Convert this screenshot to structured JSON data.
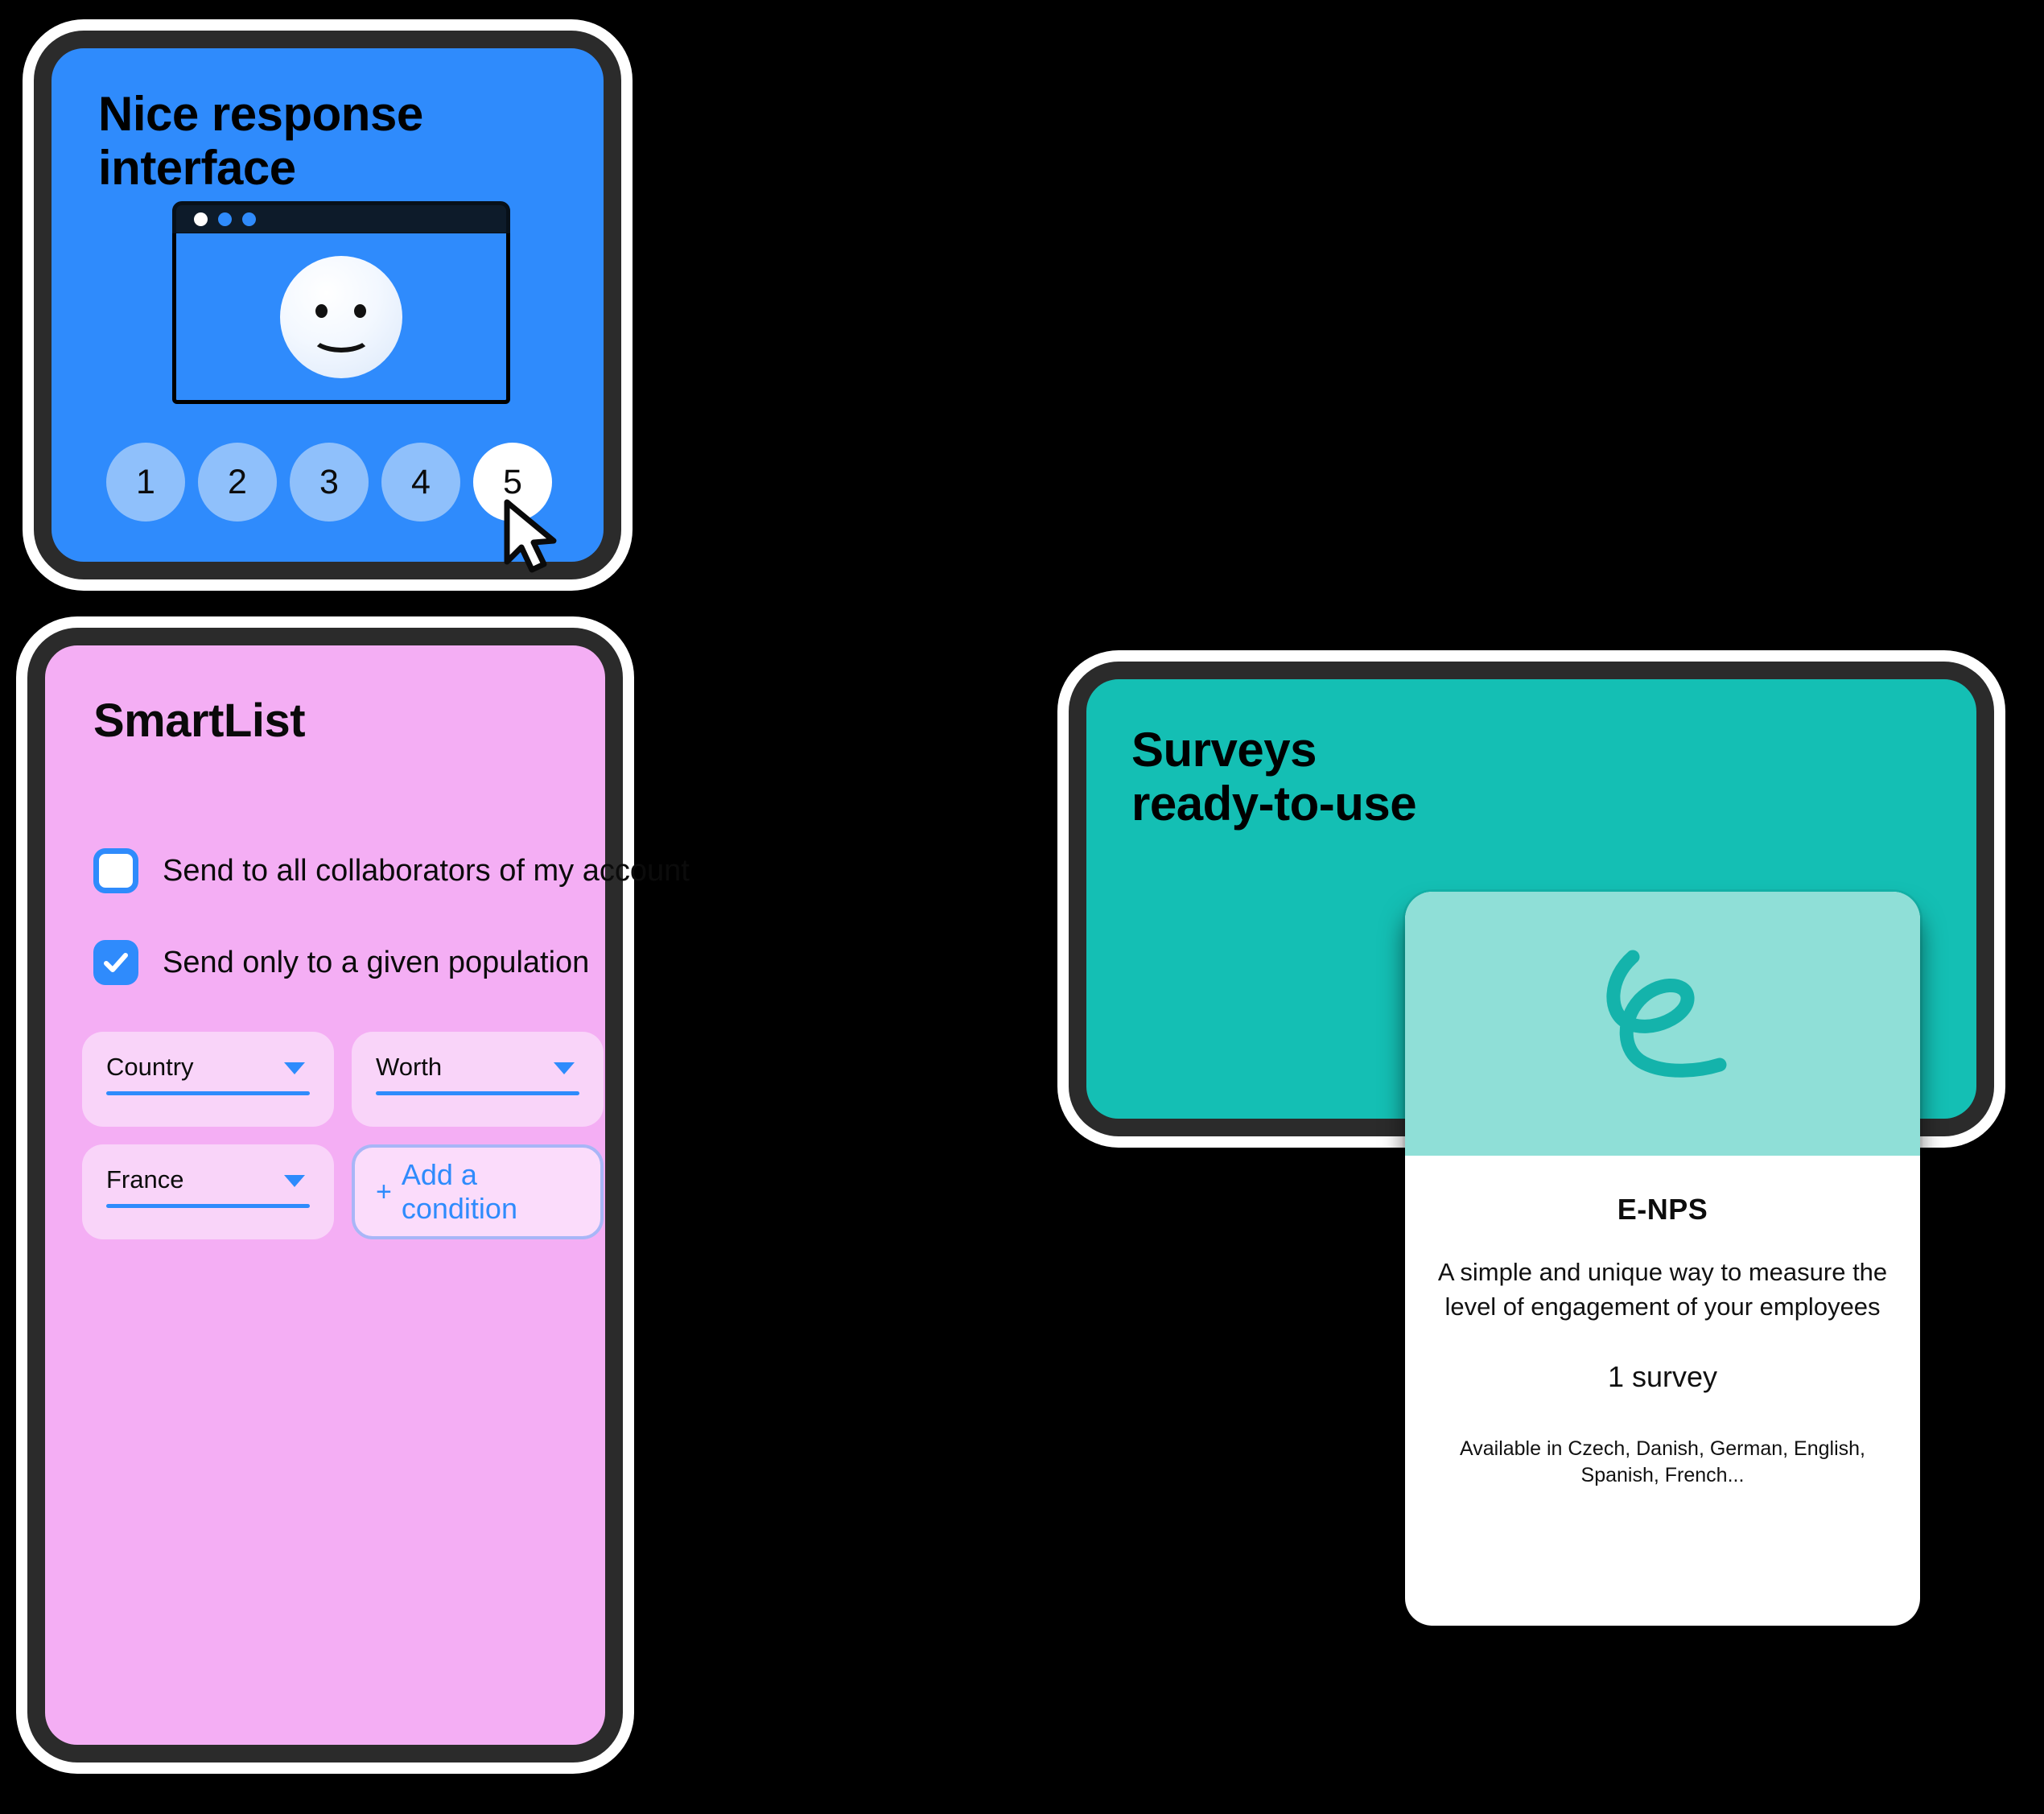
{
  "colors": {
    "background": "#000000",
    "blue_card": "#2f8bfc",
    "pink_card": "#f4aef4",
    "teal_card": "#14bfb4",
    "teal_hero": "#8fdfd7",
    "accent_blue": "#2f8bfc",
    "card_border": "#2b2b2b",
    "card_glow": "#ffffff"
  },
  "blue_card": {
    "title": "Nice response\ninterface",
    "browser": {
      "dots": [
        "window-dot-white",
        "window-dot-blue",
        "window-dot-blue"
      ],
      "content_icon": "smiley-face-icon"
    },
    "rating": {
      "options": [
        "1",
        "2",
        "3",
        "4",
        "5"
      ],
      "selected": "5",
      "cursor_icon": "mouse-pointer-icon"
    }
  },
  "pink_card": {
    "title": "SmartList",
    "checkboxes": [
      {
        "label": "Send to all collaborators of my account",
        "checked": false
      },
      {
        "label": "Send only to a given population",
        "checked": true
      }
    ],
    "fields": [
      {
        "value": "Country",
        "caret_icon": "chevron-down-icon"
      },
      {
        "value": "Worth",
        "caret_icon": "chevron-down-icon"
      },
      {
        "value": "France",
        "caret_icon": "chevron-down-icon"
      }
    ],
    "add_condition": {
      "plus": "+",
      "label": "Add a condition"
    }
  },
  "teal_card": {
    "title": "Surveys\nready-to-use",
    "survey_card": {
      "hero_icon": "cursive-e-logo",
      "name": "E-NPS",
      "description": "A simple and unique way to measure the level of engagement of your employees",
      "count": "1 survey",
      "languages": "Available in Czech, Danish, German, English, Spanish, French..."
    }
  }
}
